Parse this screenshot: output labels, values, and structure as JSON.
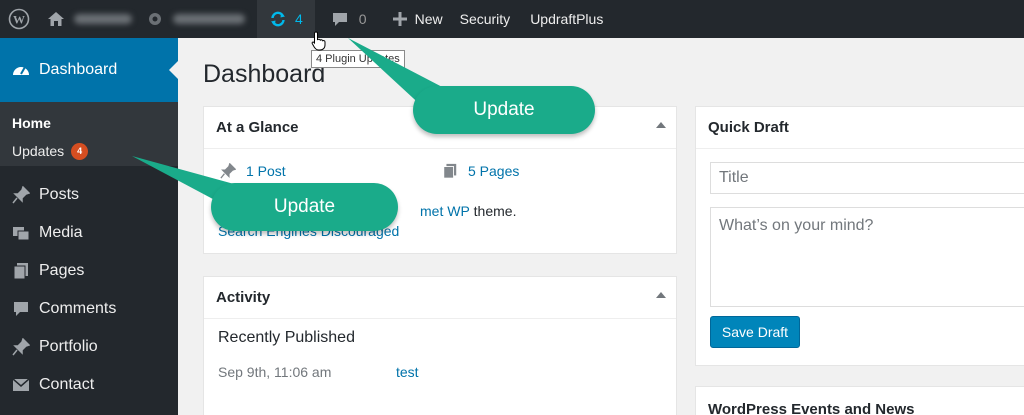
{
  "adminbar": {
    "updates_count": "4",
    "comments_count": "0",
    "new_label": "New",
    "security_label": "Security",
    "updraft_label": "UpdraftPlus"
  },
  "tooltip": "4 Plugin Updates",
  "sidebar": {
    "dashboard": "Dashboard",
    "home": "Home",
    "updates": "Updates",
    "updates_badge": "4",
    "items": [
      "Posts",
      "Media",
      "Pages",
      "Comments",
      "Portfolio",
      "Contact"
    ]
  },
  "page_title": "Dashboard",
  "glance": {
    "title": "At a Glance",
    "posts": "1 Post",
    "pages": "5 Pages",
    "theme_link": "met WP",
    "theme_suffix": " theme.",
    "search_engines": "Search Engines Discouraged"
  },
  "activity": {
    "title": "Activity",
    "recently": "Recently Published",
    "date": "Sep 9th, 11:06 am",
    "post": "test"
  },
  "quick_draft": {
    "title": "Quick Draft",
    "title_placeholder": "Title",
    "content_placeholder": "What’s on your mind?",
    "save": "Save Draft"
  },
  "events": {
    "title": "WordPress Events and News"
  },
  "callouts": {
    "top": "Update",
    "left": "Update"
  },
  "colors": {
    "adminbar": "#23282d",
    "accent": "#0073aa",
    "callout": "#1aab8a",
    "badge": "#d54e21"
  }
}
